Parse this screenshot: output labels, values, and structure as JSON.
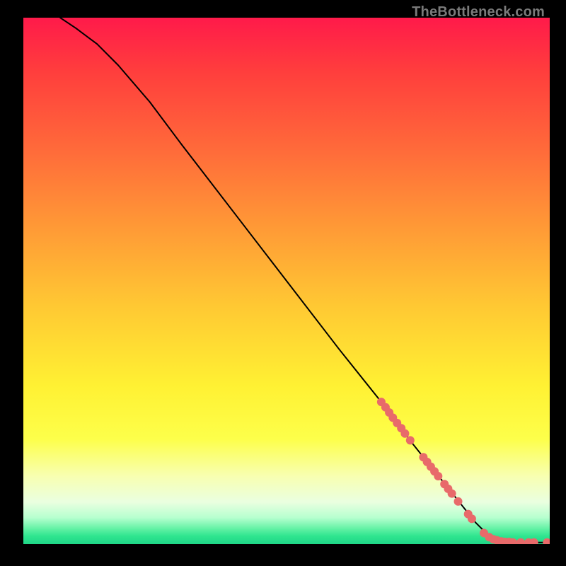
{
  "watermark": "TheBottleneck.com",
  "chart_data": {
    "type": "line",
    "title": "",
    "xlabel": "",
    "ylabel": "",
    "xlim": [
      0,
      100
    ],
    "ylim": [
      0,
      100
    ],
    "series": [
      {
        "name": "curve",
        "x": [
          7,
          10,
          14,
          18,
          24,
          30,
          40,
          50,
          60,
          68,
          74,
          78,
          82,
          86,
          88,
          90,
          92,
          94,
          96,
          98,
          100
        ],
        "y": [
          100,
          98,
          95,
          91,
          84,
          76,
          63,
          50,
          37,
          27,
          19,
          14,
          9,
          4,
          2,
          1,
          0.6,
          0.4,
          0.3,
          0.3,
          0.3
        ]
      }
    ],
    "markers": [
      {
        "x": 68.0,
        "y": 27.0
      },
      {
        "x": 68.8,
        "y": 26.0
      },
      {
        "x": 69.5,
        "y": 25.0
      },
      {
        "x": 70.2,
        "y": 24.0
      },
      {
        "x": 71.0,
        "y": 23.0
      },
      {
        "x": 71.8,
        "y": 22.0
      },
      {
        "x": 72.5,
        "y": 21.0
      },
      {
        "x": 73.5,
        "y": 19.7
      },
      {
        "x": 76.0,
        "y": 16.5
      },
      {
        "x": 76.7,
        "y": 15.6
      },
      {
        "x": 77.4,
        "y": 14.7
      },
      {
        "x": 78.1,
        "y": 13.8
      },
      {
        "x": 78.8,
        "y": 12.9
      },
      {
        "x": 80.0,
        "y": 11.4
      },
      {
        "x": 80.7,
        "y": 10.5
      },
      {
        "x": 81.4,
        "y": 9.6
      },
      {
        "x": 82.6,
        "y": 8.1
      },
      {
        "x": 84.5,
        "y": 5.7
      },
      {
        "x": 85.2,
        "y": 4.8
      },
      {
        "x": 87.5,
        "y": 2.1
      },
      {
        "x": 88.5,
        "y": 1.3
      },
      {
        "x": 89.3,
        "y": 0.9
      },
      {
        "x": 90.0,
        "y": 0.7
      },
      {
        "x": 90.8,
        "y": 0.5
      },
      {
        "x": 91.5,
        "y": 0.4
      },
      {
        "x": 92.3,
        "y": 0.4
      },
      {
        "x": 93.0,
        "y": 0.3
      },
      {
        "x": 94.5,
        "y": 0.3
      },
      {
        "x": 96.0,
        "y": 0.3
      },
      {
        "x": 97.0,
        "y": 0.3
      },
      {
        "x": 99.5,
        "y": 0.3
      }
    ],
    "marker_style": {
      "color": "#e86a6a",
      "radius": 6
    }
  }
}
